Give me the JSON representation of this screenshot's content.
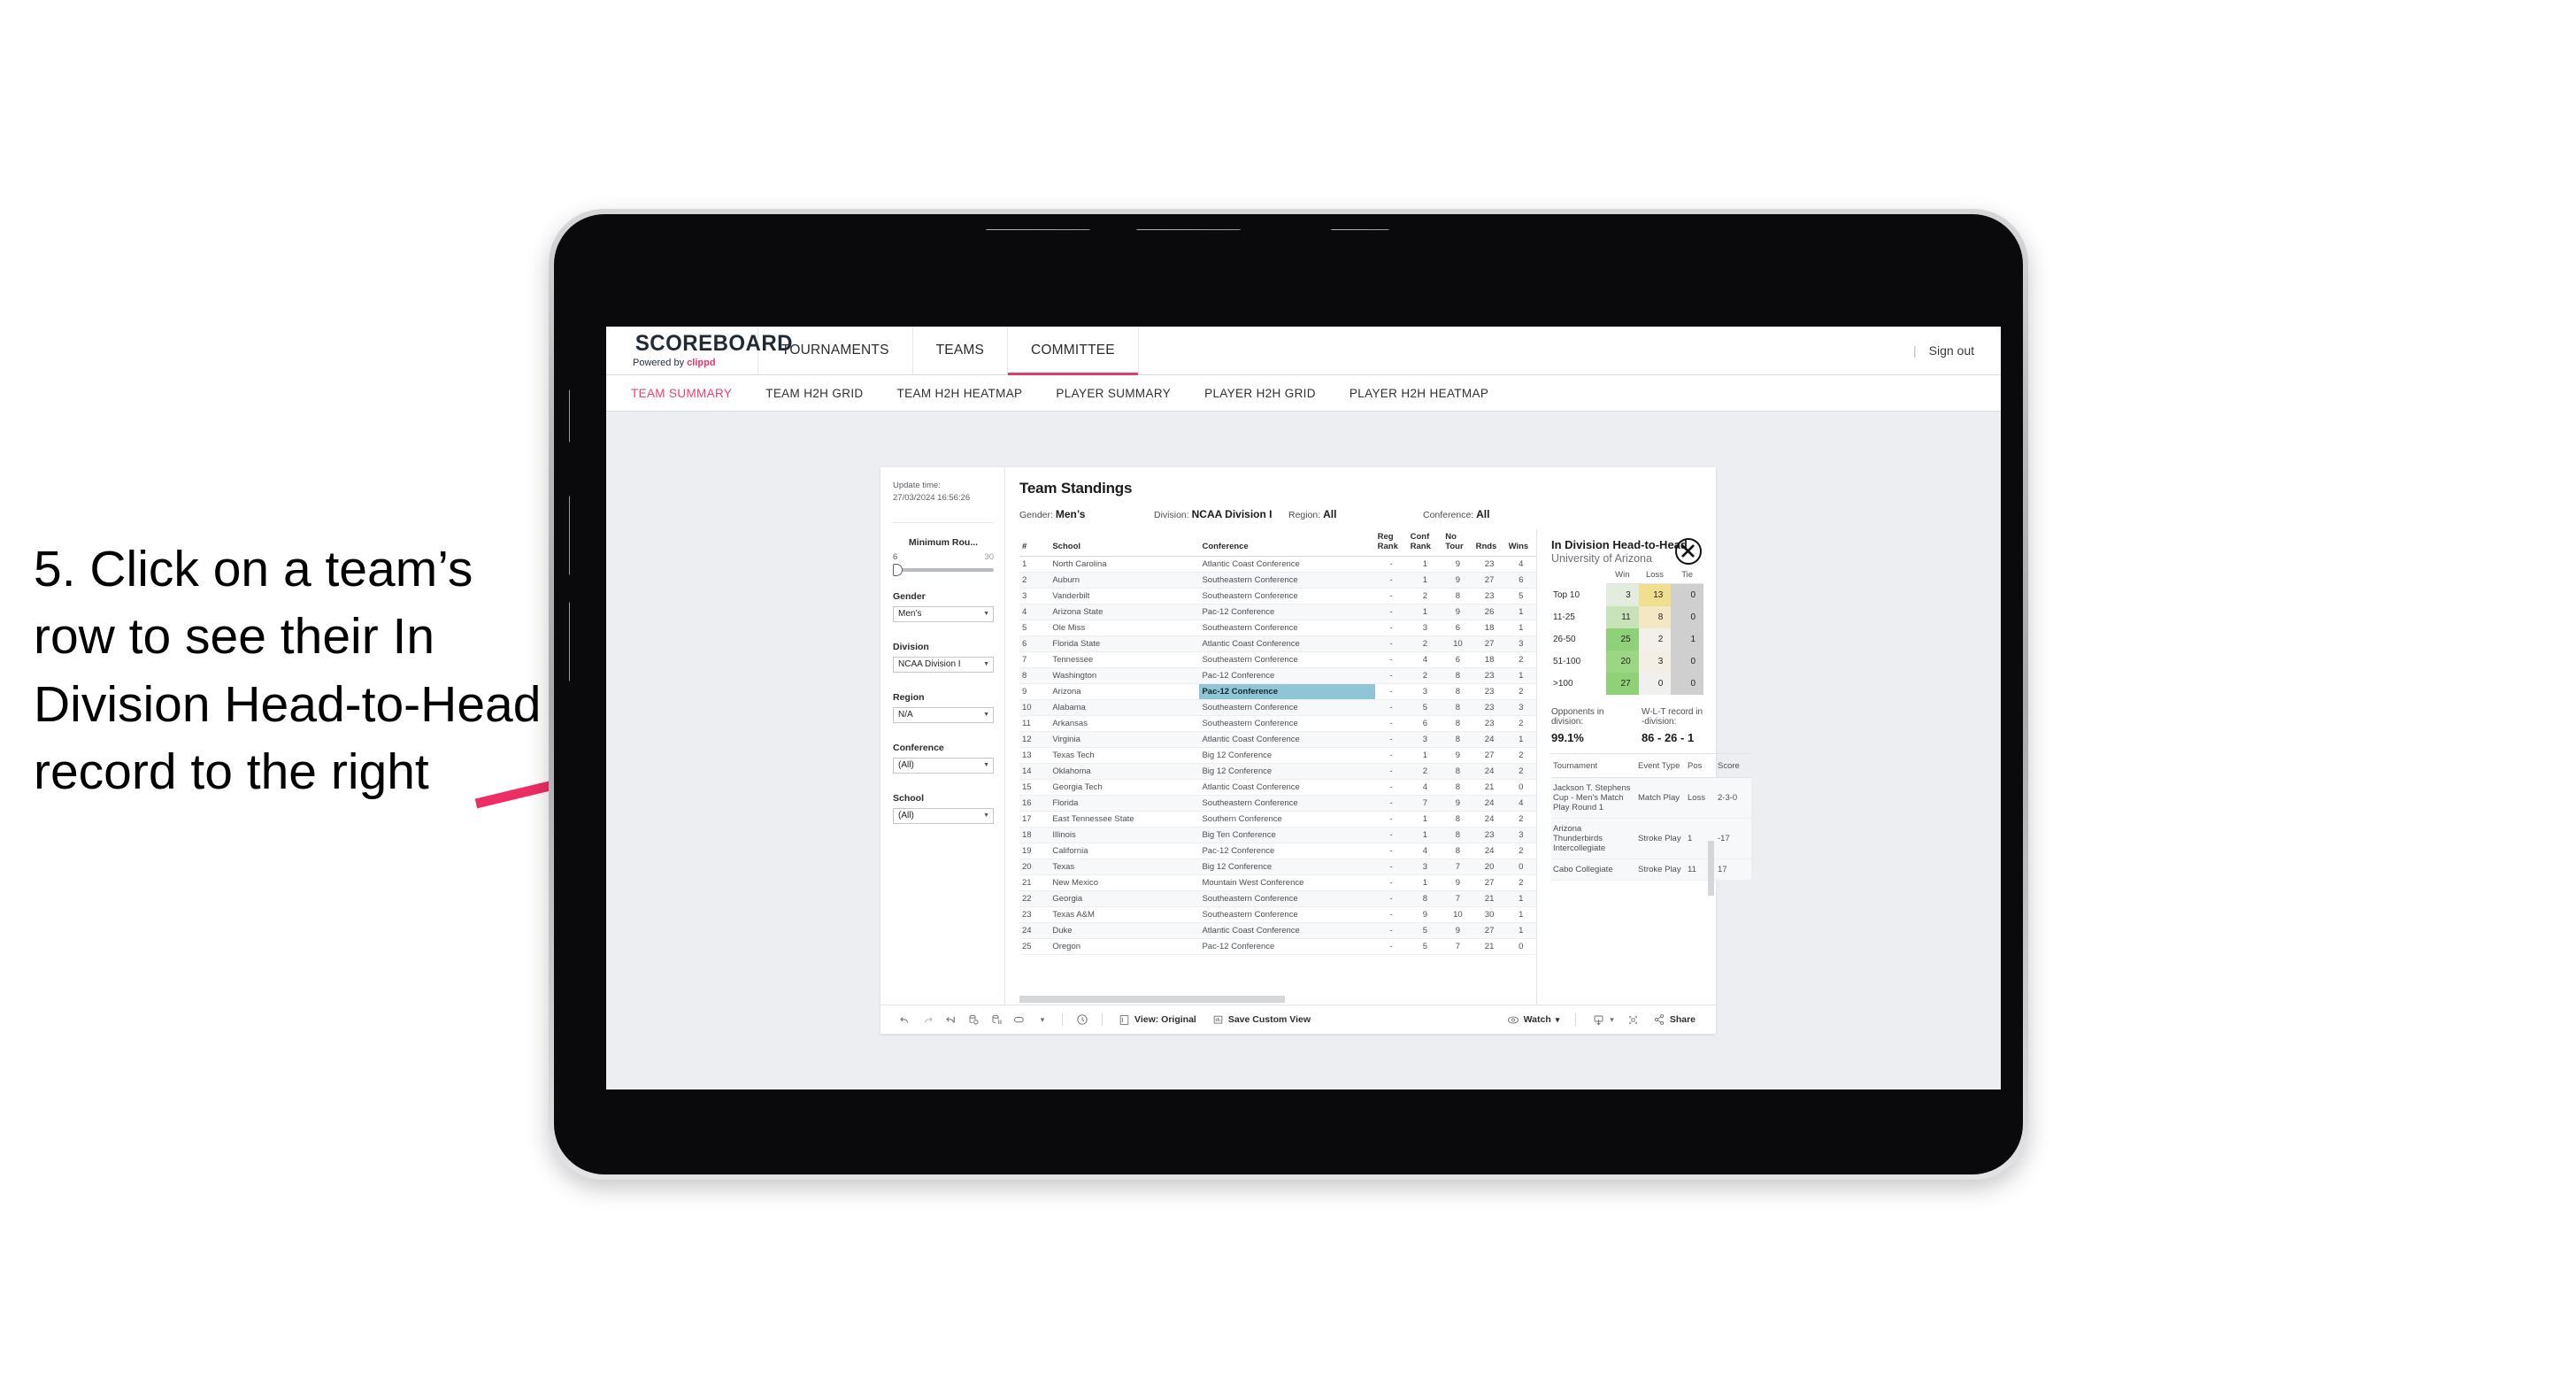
{
  "annotation": {
    "text": "5. Click on a team’s row to see their In Division Head-to-Head record to the right",
    "arrow_color": "#ee2d65"
  },
  "app": {
    "brand": {
      "wordmark": "SCOREBOARD",
      "powered_prefix": "Powered by ",
      "powered_name": "clippd",
      "accent": "#ee3366"
    },
    "topnav": {
      "items": [
        {
          "label": "TOURNAMENTS",
          "active": false
        },
        {
          "label": "TEAMS",
          "active": false
        },
        {
          "label": "COMMITTEE",
          "active": true
        }
      ],
      "divider": "|",
      "sign_out": "Sign out"
    },
    "subtabs": [
      {
        "label": "TEAM SUMMARY",
        "active": true
      },
      {
        "label": "TEAM H2H GRID",
        "active": false
      },
      {
        "label": "TEAM H2H HEATMAP",
        "active": false
      },
      {
        "label": "PLAYER SUMMARY",
        "active": false
      },
      {
        "label": "PLAYER H2H GRID",
        "active": false
      },
      {
        "label": "PLAYER H2H HEATMAP",
        "active": false
      }
    ],
    "filters": {
      "update_time_label": "Update time:",
      "update_time_value": "27/03/2024 16:56:26",
      "min_rounds": {
        "title": "Minimum Rou...",
        "min": "6",
        "max": "30"
      },
      "gender": {
        "title": "Gender",
        "value": "Men’s"
      },
      "division": {
        "title": "Division",
        "value": "NCAA Division I"
      },
      "region": {
        "title": "Region",
        "value": "N/A"
      },
      "conference": {
        "title": "Conference",
        "value": "(All)"
      },
      "school": {
        "title": "School",
        "value": "(All)"
      }
    },
    "standings": {
      "title": "Team Standings",
      "summary": [
        {
          "label": "Gender:",
          "value": "Men’s"
        },
        {
          "label": "Division:",
          "value": "NCAA Division I"
        },
        {
          "label": "Region:",
          "value": "All"
        },
        {
          "label": "Conference:",
          "value": "All"
        }
      ],
      "columns": [
        "#",
        "School",
        "Conference",
        "Reg Rank",
        "Conf Rank",
        "No Tour",
        "Rnds",
        "Wins"
      ],
      "rows": [
        {
          "rank": "1",
          "school": "North Carolina",
          "conference": "Atlantic Coast Conference",
          "reg_rank": "-",
          "conf_rank": "1",
          "no_tour": "9",
          "rnds": "23",
          "wins": "4",
          "highlight": false
        },
        {
          "rank": "2",
          "school": "Auburn",
          "conference": "Southeastern Conference",
          "reg_rank": "-",
          "conf_rank": "1",
          "no_tour": "9",
          "rnds": "27",
          "wins": "6",
          "highlight": false
        },
        {
          "rank": "3",
          "school": "Vanderbilt",
          "conference": "Southeastern Conference",
          "reg_rank": "-",
          "conf_rank": "2",
          "no_tour": "8",
          "rnds": "23",
          "wins": "5",
          "highlight": false
        },
        {
          "rank": "4",
          "school": "Arizona State",
          "conference": "Pac-12 Conference",
          "reg_rank": "-",
          "conf_rank": "1",
          "no_tour": "9",
          "rnds": "26",
          "wins": "1",
          "highlight": false
        },
        {
          "rank": "5",
          "school": "Ole Miss",
          "conference": "Southeastern Conference",
          "reg_rank": "-",
          "conf_rank": "3",
          "no_tour": "6",
          "rnds": "18",
          "wins": "1",
          "highlight": false
        },
        {
          "rank": "6",
          "school": "Florida State",
          "conference": "Atlantic Coast Conference",
          "reg_rank": "-",
          "conf_rank": "2",
          "no_tour": "10",
          "rnds": "27",
          "wins": "3",
          "highlight": false
        },
        {
          "rank": "7",
          "school": "Tennessee",
          "conference": "Southeastern Conference",
          "reg_rank": "-",
          "conf_rank": "4",
          "no_tour": "6",
          "rnds": "18",
          "wins": "2",
          "highlight": false
        },
        {
          "rank": "8",
          "school": "Washington",
          "conference": "Pac-12 Conference",
          "reg_rank": "-",
          "conf_rank": "2",
          "no_tour": "8",
          "rnds": "23",
          "wins": "1",
          "highlight": false
        },
        {
          "rank": "9",
          "school": "Arizona",
          "conference": "Pac-12 Conference",
          "reg_rank": "-",
          "conf_rank": "3",
          "no_tour": "8",
          "rnds": "23",
          "wins": "2",
          "highlight": true
        },
        {
          "rank": "10",
          "school": "Alabama",
          "conference": "Southeastern Conference",
          "reg_rank": "-",
          "conf_rank": "5",
          "no_tour": "8",
          "rnds": "23",
          "wins": "3",
          "highlight": false
        },
        {
          "rank": "11",
          "school": "Arkansas",
          "conference": "Southeastern Conference",
          "reg_rank": "-",
          "conf_rank": "6",
          "no_tour": "8",
          "rnds": "23",
          "wins": "2",
          "highlight": false
        },
        {
          "rank": "12",
          "school": "Virginia",
          "conference": "Atlantic Coast Conference",
          "reg_rank": "-",
          "conf_rank": "3",
          "no_tour": "8",
          "rnds": "24",
          "wins": "1",
          "highlight": false
        },
        {
          "rank": "13",
          "school": "Texas Tech",
          "conference": "Big 12 Conference",
          "reg_rank": "-",
          "conf_rank": "1",
          "no_tour": "9",
          "rnds": "27",
          "wins": "2",
          "highlight": false
        },
        {
          "rank": "14",
          "school": "Oklahoma",
          "conference": "Big 12 Conference",
          "reg_rank": "-",
          "conf_rank": "2",
          "no_tour": "8",
          "rnds": "24",
          "wins": "2",
          "highlight": false
        },
        {
          "rank": "15",
          "school": "Georgia Tech",
          "conference": "Atlantic Coast Conference",
          "reg_rank": "-",
          "conf_rank": "4",
          "no_tour": "8",
          "rnds": "21",
          "wins": "0",
          "highlight": false
        },
        {
          "rank": "16",
          "school": "Florida",
          "conference": "Southeastern Conference",
          "reg_rank": "-",
          "conf_rank": "7",
          "no_tour": "9",
          "rnds": "24",
          "wins": "4",
          "highlight": false
        },
        {
          "rank": "17",
          "school": "East Tennessee State",
          "conference": "Southern Conference",
          "reg_rank": "-",
          "conf_rank": "1",
          "no_tour": "8",
          "rnds": "24",
          "wins": "2",
          "highlight": false
        },
        {
          "rank": "18",
          "school": "Illinois",
          "conference": "Big Ten Conference",
          "reg_rank": "-",
          "conf_rank": "1",
          "no_tour": "8",
          "rnds": "23",
          "wins": "3",
          "highlight": false
        },
        {
          "rank": "19",
          "school": "California",
          "conference": "Pac-12 Conference",
          "reg_rank": "-",
          "conf_rank": "4",
          "no_tour": "8",
          "rnds": "24",
          "wins": "2",
          "highlight": false
        },
        {
          "rank": "20",
          "school": "Texas",
          "conference": "Big 12 Conference",
          "reg_rank": "-",
          "conf_rank": "3",
          "no_tour": "7",
          "rnds": "20",
          "wins": "0",
          "highlight": false
        },
        {
          "rank": "21",
          "school": "New Mexico",
          "conference": "Mountain West Conference",
          "reg_rank": "-",
          "conf_rank": "1",
          "no_tour": "9",
          "rnds": "27",
          "wins": "2",
          "highlight": false
        },
        {
          "rank": "22",
          "school": "Georgia",
          "conference": "Southeastern Conference",
          "reg_rank": "-",
          "conf_rank": "8",
          "no_tour": "7",
          "rnds": "21",
          "wins": "1",
          "highlight": false
        },
        {
          "rank": "23",
          "school": "Texas A&M",
          "conference": "Southeastern Conference",
          "reg_rank": "-",
          "conf_rank": "9",
          "no_tour": "10",
          "rnds": "30",
          "wins": "1",
          "highlight": false
        },
        {
          "rank": "24",
          "school": "Duke",
          "conference": "Atlantic Coast Conference",
          "reg_rank": "-",
          "conf_rank": "5",
          "no_tour": "9",
          "rnds": "27",
          "wins": "1",
          "highlight": false
        },
        {
          "rank": "25",
          "school": "Oregon",
          "conference": "Pac-12 Conference",
          "reg_rank": "-",
          "conf_rank": "5",
          "no_tour": "7",
          "rnds": "21",
          "wins": "0",
          "highlight": false
        }
      ]
    },
    "h2h": {
      "title": "In Division Head-to-Head",
      "subtitle": "University of Arizona",
      "close_icon": "close-icon",
      "opponents_label": "Opponents in division:",
      "opponents_value": "99.1%",
      "record_label": "W-L-T record in -division:",
      "record_value": "86 - 26 - 1",
      "tournaments_columns": [
        "Tournament",
        "Event Type",
        "Pos",
        "Score"
      ],
      "tournaments": [
        {
          "name": "Jackson T. Stephens Cup - Men’s Match Play Round 1",
          "type": "Match Play",
          "pos": "Loss",
          "score": "2-3-0"
        },
        {
          "name": "Arizona Thunderbirds Intercollegiate",
          "type": "Stroke Play",
          "pos": "1",
          "score": "-17"
        },
        {
          "name": "Cabo Collegiate",
          "type": "Stroke Play",
          "pos": "11",
          "score": "17"
        }
      ]
    },
    "toolbar": {
      "icons": [
        "undo-icon",
        "redo-icon",
        "revert-icon",
        "refresh-data-icon",
        "pause-updates-icon",
        "alert-icon"
      ],
      "dropdown_caret": "▾",
      "clock_icon": "clock-icon",
      "view_label": "View: Original",
      "save_label": "Save Custom View",
      "watch_label": "Watch",
      "download_icon": "download-icon",
      "fullscreen_icon": "fullscreen-icon",
      "share_label": "Share"
    }
  },
  "chart_data": {
    "type": "heatmap",
    "title": "In Division Head-to-Head",
    "subtitle": "University of Arizona",
    "columns": [
      "Win",
      "Loss",
      "Tie"
    ],
    "rows": [
      "Top 10",
      "11-25",
      "26-50",
      "51-100",
      ">100"
    ],
    "values": [
      [
        3,
        13,
        0
      ],
      [
        11,
        8,
        0
      ],
      [
        25,
        2,
        1
      ],
      [
        20,
        3,
        0
      ],
      [
        27,
        0,
        0
      ]
    ],
    "cell_colors": [
      [
        "#e2ecdf",
        "#efdf8e",
        "#cfcfcf"
      ],
      [
        "#c8e3b9",
        "#f2e9c4",
        "#cfcfcf"
      ],
      [
        "#8fd178",
        "#f2f0e9",
        "#cfcfcf"
      ],
      [
        "#9bd684",
        "#f3efe4",
        "#cfcfcf"
      ],
      [
        "#8ed177",
        "#f0f0ee",
        "#cfcfcf"
      ]
    ],
    "legend_position": "none",
    "grid": false
  }
}
